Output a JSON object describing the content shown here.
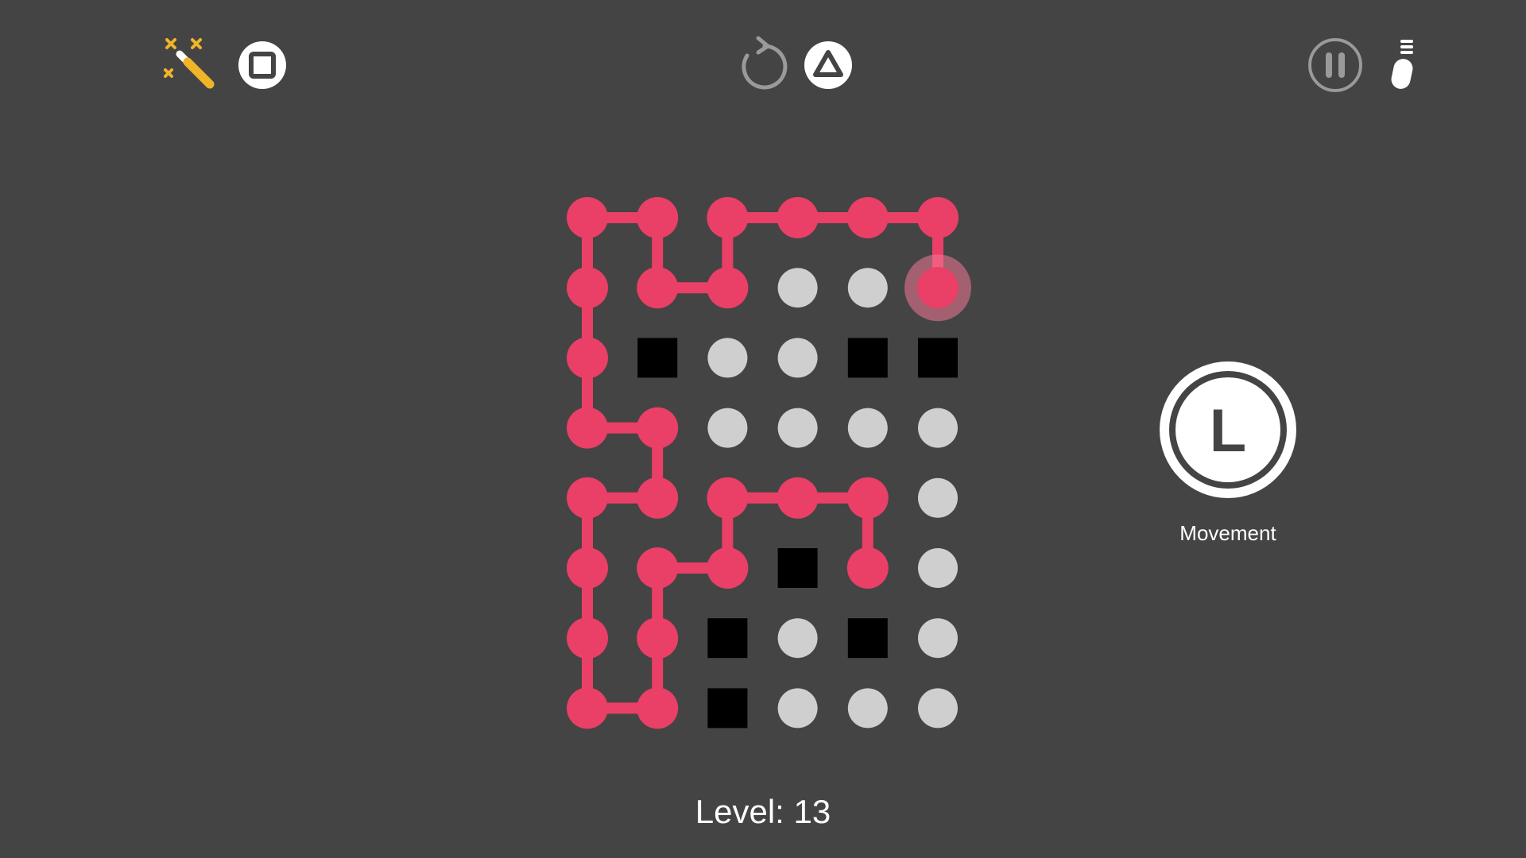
{
  "toolbar": {
    "left": [
      {
        "name": "magic-wand-icon",
        "color": "#f0b429"
      },
      {
        "name": "square-button-icon",
        "color": "#ffffff"
      }
    ],
    "center": [
      {
        "name": "restart-icon",
        "color": "#9a9a9a"
      },
      {
        "name": "triangle-button-icon",
        "color": "#ffffff"
      }
    ],
    "right": [
      {
        "name": "pause-icon",
        "color": "#9a9a9a"
      },
      {
        "name": "hint-bulb-icon",
        "color": "#ffffff"
      }
    ]
  },
  "board": {
    "columns": 6,
    "rows": 8,
    "colors": {
      "path": "#ea3f66",
      "empty": "#cfcfcf",
      "wall": "#000000",
      "head_glow": "#f07896"
    },
    "walls": [
      [
        1,
        2
      ],
      [
        4,
        2
      ],
      [
        5,
        2
      ],
      [
        3,
        5
      ],
      [
        2,
        6
      ],
      [
        4,
        6
      ],
      [
        2,
        7
      ]
    ],
    "path_segments": [
      [
        [
          0,
          0
        ],
        [
          1,
          0
        ],
        [
          1,
          1
        ],
        [
          2,
          1
        ],
        [
          2,
          0
        ],
        [
          3,
          0
        ],
        [
          4,
          0
        ],
        [
          5,
          0
        ],
        [
          5,
          1
        ]
      ],
      [
        [
          0,
          0
        ],
        [
          0,
          1
        ],
        [
          0,
          2
        ],
        [
          0,
          3
        ],
        [
          1,
          3
        ],
        [
          1,
          4
        ],
        [
          0,
          4
        ],
        [
          0,
          5
        ],
        [
          0,
          6
        ],
        [
          0,
          7
        ],
        [
          1,
          7
        ],
        [
          1,
          6
        ],
        [
          1,
          5
        ],
        [
          2,
          5
        ],
        [
          2,
          4
        ],
        [
          3,
          4
        ],
        [
          4,
          4
        ],
        [
          4,
          5
        ]
      ]
    ],
    "head": [
      5,
      1
    ]
  },
  "movement_control": {
    "button_letter": "L",
    "label": "Movement"
  },
  "level": {
    "text": "Level: 13"
  }
}
